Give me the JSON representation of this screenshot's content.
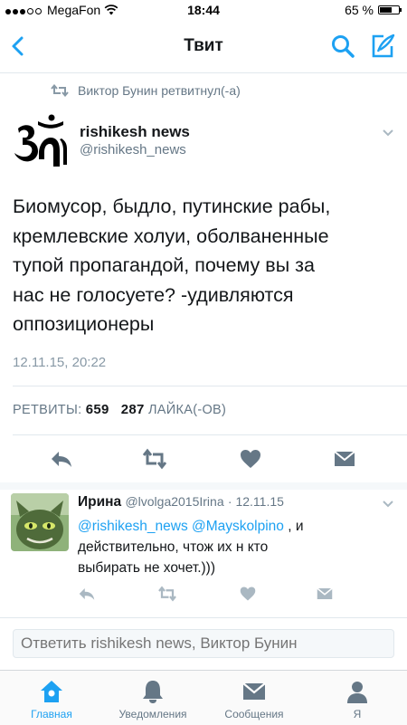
{
  "status_bar": {
    "carrier": "MegaFon",
    "time": "18:44",
    "battery": "65 %",
    "battery_level": 0.65
  },
  "nav": {
    "title": "Твит",
    "accent": "#1da1f2"
  },
  "tweet": {
    "retweet_context": "Виктор Бунин ретвитнул(-а)",
    "author_name": "rishikesh news",
    "author_handle": "@rishikesh_news",
    "lines": [
      "Биомусор, быдло, путинские рабы,",
      "кремлевские холуи, оболваненные",
      "тупой пропагандой, почему вы за",
      "нас не голосуете? -удивляются",
      "оппозиционеры"
    ],
    "timestamp": "12.11.15, 20:22",
    "retweets_label": "РЕТВИТЫ:",
    "retweets_count": "659",
    "likes_count": "287",
    "likes_label": "ЛАЙКА(-ОВ)"
  },
  "reply": {
    "name": "Ирина",
    "handle": "@lvolga2015Irina",
    "date": "· 12.11.15",
    "mention1": "@rishikesh_news",
    "mention2": "@Mayskolpino",
    "text_tail": " , и",
    "text_line2": "действительно, чтож их н кто",
    "text_line3": "выбирать не хочет.)))"
  },
  "compose": {
    "placeholder": "Ответить rishikesh news, Виктор Бунин"
  },
  "tabs": [
    {
      "label": "Главная",
      "icon": "home-icon"
    },
    {
      "label": "Уведомления",
      "icon": "bell-icon"
    },
    {
      "label": "Сообщения",
      "icon": "envelope-icon"
    },
    {
      "label": "Я",
      "icon": "person-icon"
    }
  ]
}
